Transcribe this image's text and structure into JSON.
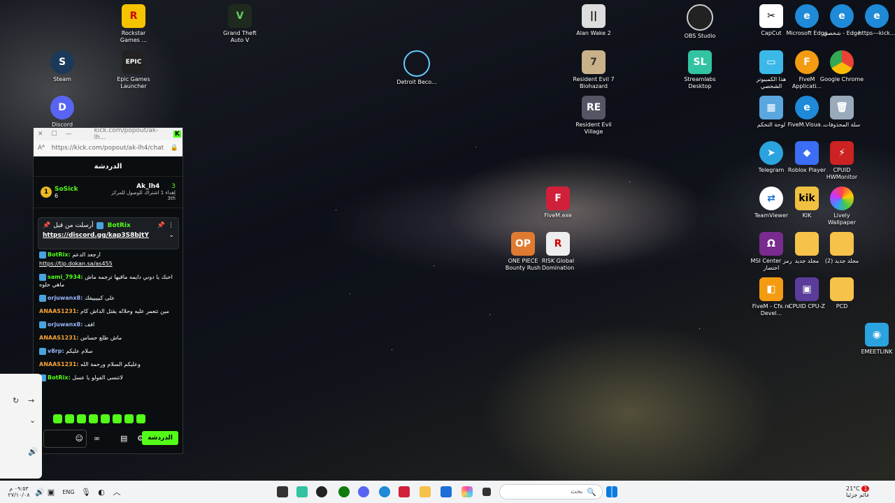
{
  "desktop": {
    "icons": {
      "rockstar": "Rockstar Games ...",
      "gta": "Grand Theft Auto V",
      "steam": "Steam",
      "epic": "Epic Games Launcher",
      "discord": "Discord",
      "detroit": "Detroit Beco...",
      "alanwake": "Alan Wake 2",
      "re7": "Resident Evil 7 Biohazard",
      "revillage": "Resident Evil Village",
      "fivemexe": "FiveM.exe",
      "onepiece": "ONE PIECE Bounty Rush",
      "risk": "RISK Global Domination",
      "obs": "OBS Studio",
      "streamlabs": "Streamlabs Desktop",
      "capcut": "CapCut",
      "edge": "Microsoft Edge",
      "edge_ar": "شخصي - Edge",
      "edge_https": "https---kick...",
      "thispc": "هذا الكمبيوتر الشخصي",
      "fivemapp": "FiveM Applicati...",
      "chrome": "Google Chrome",
      "controlpanel": "لوحة التحكم",
      "fivemvisual": "FiveM.Visua...",
      "recycle": "سلة المحذوفات",
      "telegram": "Telegram",
      "roblox": "Roblox Player",
      "cpuidhw": "CPUID HWMonitor",
      "teamviewer": "TeamViewer",
      "kik": "KIK",
      "lively": "Lively Wallpaper",
      "msi": "MSI Center رمز اختصار",
      "newfolder": "مجلد جديد",
      "newfolder2": "مجلد جديد (2)",
      "fivemcfx": "FiveM - Cfx.re Devel...",
      "cpuz": "CPUID CPU-Z",
      "pcd": "PCD",
      "emeet": "EMEETLINK"
    }
  },
  "chat_window": {
    "title": "kick.com/popout/ak-lh...",
    "url": "https://kick.com/popout/ak-lh4/chat",
    "header": "الدردشة",
    "leader1_name": "SoSick",
    "leader1_rank": "1",
    "leader1_count": "6",
    "leader2_name": "Ak_lh4",
    "leader2_count": "3",
    "leader2_goal": "إهداء 1 اشتراك للوصول للمركز",
    "leader2_place": "3th",
    "pinned_by": "أرسلت من قبل",
    "pinned_user": "BotRix",
    "pinned_link": "https://discord.gg/kap3S8bJtY",
    "messages": [
      {
        "user": "BotRix:",
        "text": "ارجعد الدعم",
        "color": "#53fc18"
      },
      {
        "user": "",
        "text": "https://tip.dokan.sa/as455",
        "color": "#fff"
      },
      {
        "user": "sami_7934:",
        "text": "احبك يا دوني دايمه ماقيها ترجمه ماش ماهي حلوه",
        "color": "#53fc18"
      },
      {
        "user": "orjuwanx8:",
        "text": "على كيييييفك",
        "color": "#9ab7ff"
      },
      {
        "user": "ANAAS1231:",
        "text": "مين تتعمر عليه وحلاله يقتل الداش كام",
        "color": "#f7a23b"
      },
      {
        "user": "orjuwanx8:",
        "text": "افف",
        "color": "#9ab7ff"
      },
      {
        "user": "ANAAS1231:",
        "text": "ماش طلع حساس",
        "color": "#f7a23b"
      },
      {
        "user": "v8rp:",
        "text": "سلام عليكم",
        "color": "#9ab7ff"
      },
      {
        "user": "ANAAS1231:",
        "text": "وعليكم السلام ورحمة الله",
        "color": "#f7a23b"
      },
      {
        "user": "BotRix:",
        "text": "لاتنسى الفولو يا عسل",
        "color": "#53fc18"
      }
    ],
    "send_label": "الدردشة"
  },
  "taskbar": {
    "time": "٠٩:٥٣ م",
    "date": "٢٧/١٠/٠٨",
    "lang": "ENG",
    "search_placeholder": "بحث",
    "weather_temp": "21°C",
    "weather_text": "غائم جزئيا",
    "notif_count": "1"
  }
}
